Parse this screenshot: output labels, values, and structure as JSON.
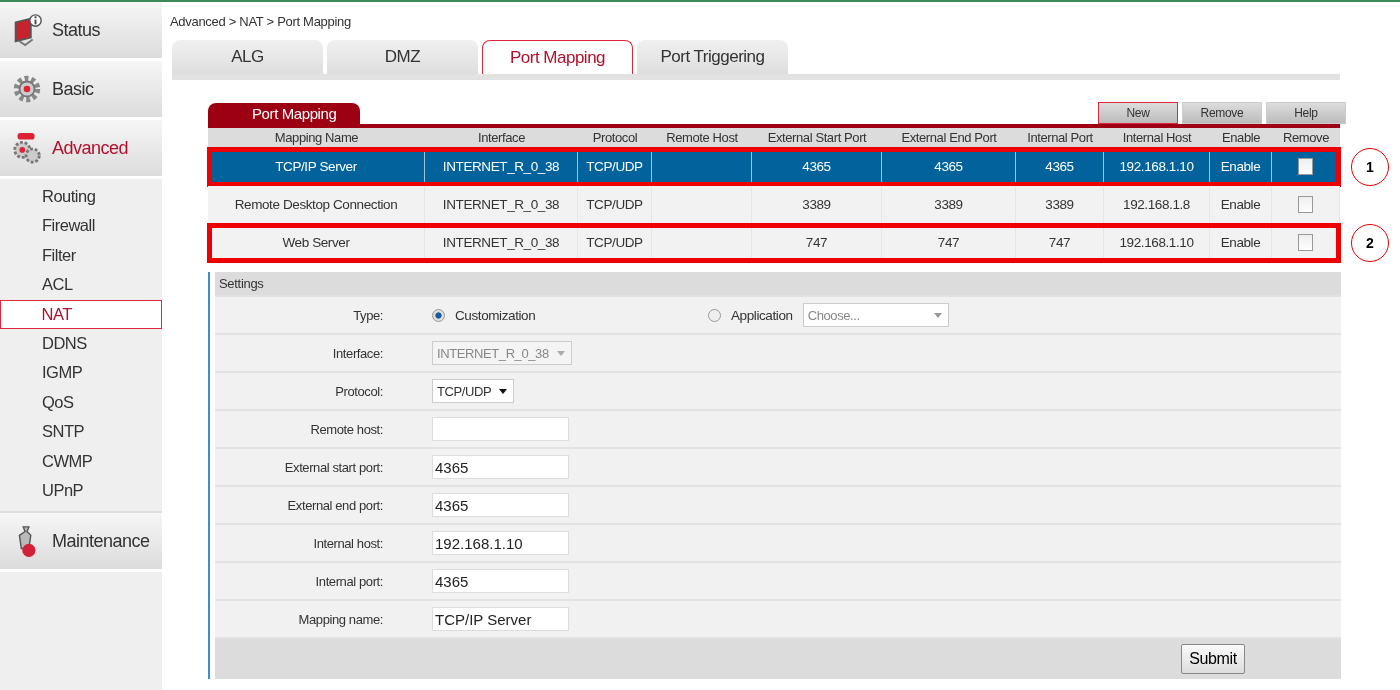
{
  "sidebar": {
    "sections": [
      {
        "label": "Status",
        "active": false
      },
      {
        "label": "Basic",
        "active": false
      },
      {
        "label": "Advanced",
        "active": true,
        "children": [
          {
            "label": "Routing",
            "selected": false
          },
          {
            "label": "Firewall",
            "selected": false
          },
          {
            "label": "Filter",
            "selected": false
          },
          {
            "label": "ACL",
            "selected": false
          },
          {
            "label": "NAT",
            "selected": true
          },
          {
            "label": "DDNS",
            "selected": false
          },
          {
            "label": "IGMP",
            "selected": false
          },
          {
            "label": "QoS",
            "selected": false
          },
          {
            "label": "SNTP",
            "selected": false
          },
          {
            "label": "CWMP",
            "selected": false
          },
          {
            "label": "UPnP",
            "selected": false
          }
        ]
      },
      {
        "label": "Maintenance",
        "active": false
      }
    ]
  },
  "breadcrumb": "Advanced > NAT > Port Mapping",
  "tabs": [
    {
      "label": "ALG",
      "selected": false
    },
    {
      "label": "DMZ",
      "selected": false
    },
    {
      "label": "Port Mapping",
      "selected": true
    },
    {
      "label": "Port Triggering",
      "selected": false
    }
  ],
  "panel": {
    "title": "Port Mapping",
    "buttons": [
      {
        "label": "New",
        "selected": true
      },
      {
        "label": "Remove",
        "selected": false
      },
      {
        "label": "Help",
        "selected": false
      }
    ],
    "table": {
      "columns": [
        "Mapping Name",
        "Interface",
        "Protocol",
        "Remote Host",
        "External Start Port",
        "External End Port",
        "Internal Port",
        "Internal Host",
        "Enable",
        "Remove"
      ],
      "rows": [
        {
          "cells": [
            "TCP/IP Server",
            "INTERNET_R_0_38",
            "TCP/UDP",
            "",
            "4365",
            "4365",
            "4365",
            "192.168.1.10",
            "Enable"
          ],
          "checked": false,
          "selected": true,
          "outlined": true,
          "callout": "1"
        },
        {
          "cells": [
            "Remote Desktop Connection",
            "INTERNET_R_0_38",
            "TCP/UDP",
            "",
            "3389",
            "3389",
            "3389",
            "192.168.1.8",
            "Enable"
          ],
          "checked": false,
          "selected": false,
          "outlined": false
        },
        {
          "cells": [
            "Web Server",
            "INTERNET_R_0_38",
            "TCP/UDP",
            "",
            "747",
            "747",
            "747",
            "192.168.1.10",
            "Enable"
          ],
          "checked": false,
          "selected": false,
          "outlined": true,
          "callout": "2"
        }
      ]
    }
  },
  "settings": {
    "title": "Settings",
    "fields": [
      {
        "kind": "radio",
        "label": "Type:",
        "options": [
          {
            "label": "Customization",
            "selected": true
          },
          {
            "label": "Application",
            "selected": false
          }
        ],
        "select_placeholder": "Choose..."
      },
      {
        "kind": "select",
        "label": "Interface:",
        "value": "INTERNET_R_0_38",
        "disabled": true
      },
      {
        "kind": "select",
        "label": "Protocol:",
        "value": "TCP/UDP",
        "disabled": false
      },
      {
        "kind": "input",
        "label": "Remote host:"
      },
      {
        "kind": "input",
        "label": "External start port:",
        "value": "4365"
      },
      {
        "kind": "input",
        "label": "External end port:",
        "value": "4365"
      },
      {
        "kind": "input",
        "label": "Internal host:",
        "value": "192.168.1.10"
      },
      {
        "kind": "input",
        "label": "Internal port:",
        "value": "4365"
      },
      {
        "kind": "input",
        "label": "Mapping name:",
        "value": "TCP/IP Server"
      }
    ],
    "submit": "Submit"
  }
}
